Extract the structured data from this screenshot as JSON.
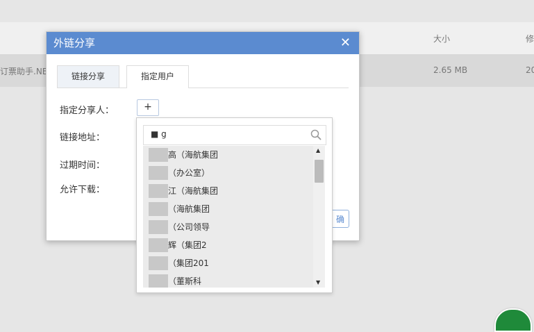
{
  "background": {
    "col_size": "大小",
    "col_modified": "修",
    "file_name": "订票助手.NE",
    "file_size": "2.65 MB",
    "file_date": "20"
  },
  "dialog": {
    "title": "外链分享",
    "close": "✕",
    "tabs": [
      "链接分享",
      "指定用户"
    ],
    "labels": {
      "share_to": "指定分享人：",
      "link": "链接地址：",
      "expire": "过期时间：",
      "download": "允许下载："
    },
    "add_button": "+",
    "confirm_partial": "确"
  },
  "dropdown": {
    "search_value": "■ g",
    "items": [
      "高（海航集团",
      "（办公室）",
      "江（海航集团",
      "（海航集团",
      "（公司领导",
      "辉（集团2",
      "（集团201",
      "（董斯科"
    ]
  },
  "colors": {
    "title_bar": "#5b8bd0",
    "badge": "#1f8a3a"
  }
}
